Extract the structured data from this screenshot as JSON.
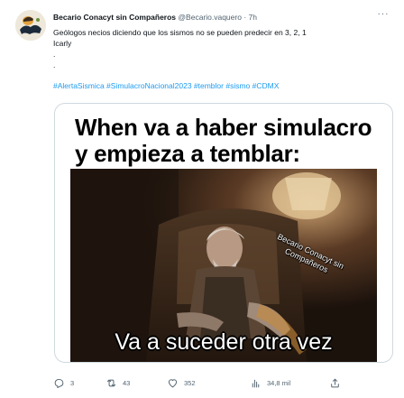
{
  "tweet": {
    "author_name": "Becario Conacyt sin Compañeros",
    "handle": "@Becario.vaquero",
    "separator": "·",
    "time": "7h",
    "more_label": "···",
    "text_line1": "Geólogos necios diciendo que los sismos no se pueden predecir en 3, 2, 1",
    "text_line2": "Icarly",
    "text_line3": ".",
    "text_line4": ".",
    "hashtags": "#AlertaSismica #SimulacroNacional2023 #temblor #sismo #CDMX",
    "meme": {
      "caption": "When va a haber simulacro y empieza a temblar:",
      "watermark": "Becario Conacyt sin Compañeros",
      "scene_caption": "Va a suceder otra vez"
    },
    "actions": {
      "replies": "3",
      "retweets": "43",
      "likes": "352",
      "views": "34,8 mil"
    }
  }
}
